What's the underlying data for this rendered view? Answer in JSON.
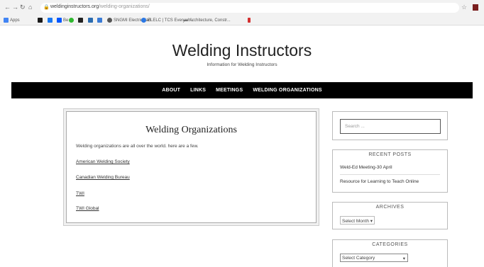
{
  "browser": {
    "url_domain": "weldinginstructors.org",
    "url_path": "/welding-organizations/",
    "bookmarks": [
      {
        "label": "Apps",
        "color": "#4285f4"
      },
      {
        "label": "",
        "color": "#1a1a1a"
      },
      {
        "label": "",
        "color": "#1877f2"
      },
      {
        "label": "Be",
        "color": "#0057ff"
      },
      {
        "label": "",
        "color": "#2eb82e"
      },
      {
        "label": "",
        "color": "#222222"
      },
      {
        "label": "",
        "color": "#2b6cb0"
      },
      {
        "label": "",
        "color": "#3a7bd5"
      },
      {
        "label": "SNGMI Electricidad",
        "color": "#555555"
      },
      {
        "label": "ELELC | TCS Everywh...",
        "color": "#2b78e4"
      },
      {
        "label": "Architecture, Constr...",
        "color": "#777777"
      },
      {
        "label": "",
        "color": "#d32f2f"
      }
    ]
  },
  "site": {
    "title": "Welding Instructors",
    "description": "Information for Welding Instructors"
  },
  "nav": {
    "items": [
      "ABOUT",
      "LINKS",
      "MEETINGS",
      "WELDING ORGANIZATIONS"
    ]
  },
  "article": {
    "title": "Welding Organizations",
    "intro": "Welding organizations are all over the world. here are a few.",
    "links": [
      "American Welding Society",
      "Canadian Welding Bureau",
      "TWI",
      "TWI Global"
    ]
  },
  "sidebar": {
    "search_placeholder": "Search ...",
    "recent_posts_title": "RECENT POSTS",
    "recent_posts": [
      "Weld-Ed Meeting-30 April",
      "Resource for Learning to Teach Online"
    ],
    "archives_title": "ARCHIVES",
    "archives_select": "Select Month",
    "categories_title": "CATEGORIES",
    "categories_select": "Select Category"
  }
}
